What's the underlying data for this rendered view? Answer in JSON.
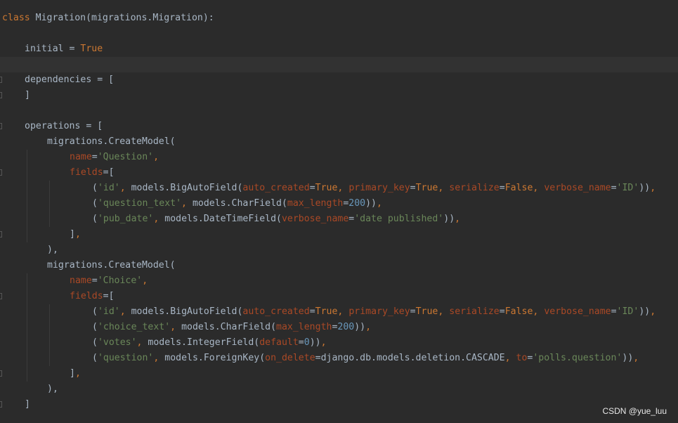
{
  "theme": {
    "background": "#2b2b2b",
    "current_line": "#323232",
    "keyword": "#cc7832",
    "parameter": "#aa4926",
    "string": "#6a8759",
    "number": "#6897bb",
    "text": "#a9b7c6"
  },
  "editor": {
    "language": "python",
    "current_line_index": 3,
    "lines": [
      {
        "indent": 0,
        "fold": false,
        "tokens": [
          [
            "kw",
            "class"
          ],
          [
            "txt",
            " Migration(migrations.Migration):"
          ]
        ]
      },
      {
        "indent": 0,
        "fold": false,
        "tokens": []
      },
      {
        "indent": 1,
        "fold": false,
        "tokens": [
          [
            "txt",
            "initial = "
          ],
          [
            "kw",
            "True"
          ]
        ]
      },
      {
        "indent": 0,
        "fold": false,
        "tokens": []
      },
      {
        "indent": 1,
        "fold": true,
        "tokens": [
          [
            "txt",
            "dependencies = ["
          ]
        ]
      },
      {
        "indent": 1,
        "fold": true,
        "tokens": [
          [
            "txt",
            "]"
          ]
        ]
      },
      {
        "indent": 0,
        "fold": false,
        "tokens": []
      },
      {
        "indent": 1,
        "fold": true,
        "tokens": [
          [
            "txt",
            "operations = ["
          ]
        ]
      },
      {
        "indent": 2,
        "fold": false,
        "tokens": [
          [
            "txt",
            "migrations.CreateModel("
          ]
        ]
      },
      {
        "indent": 3,
        "fold": false,
        "tokens": [
          [
            "par",
            "name"
          ],
          [
            "txt",
            "="
          ],
          [
            "str",
            "'Question'"
          ],
          [
            "kw",
            ","
          ]
        ]
      },
      {
        "indent": 3,
        "fold": true,
        "tokens": [
          [
            "par",
            "fields"
          ],
          [
            "txt",
            "=["
          ]
        ]
      },
      {
        "indent": 4,
        "fold": false,
        "tokens": [
          [
            "txt",
            "("
          ],
          [
            "str",
            "'id'"
          ],
          [
            "kw",
            ","
          ],
          [
            "txt",
            " models.BigAutoField("
          ],
          [
            "par",
            "auto_created"
          ],
          [
            "txt",
            "="
          ],
          [
            "kw",
            "True"
          ],
          [
            "kw",
            ","
          ],
          [
            "txt",
            " "
          ],
          [
            "par",
            "primary_key"
          ],
          [
            "txt",
            "="
          ],
          [
            "kw",
            "True"
          ],
          [
            "kw",
            ","
          ],
          [
            "txt",
            " "
          ],
          [
            "par",
            "serialize"
          ],
          [
            "txt",
            "="
          ],
          [
            "kw",
            "False"
          ],
          [
            "kw",
            ","
          ],
          [
            "txt",
            " "
          ],
          [
            "par",
            "verbose_name"
          ],
          [
            "txt",
            "="
          ],
          [
            "str",
            "'ID'"
          ],
          [
            "txt",
            "))"
          ],
          [
            "kw",
            ","
          ]
        ]
      },
      {
        "indent": 4,
        "fold": false,
        "tokens": [
          [
            "txt",
            "("
          ],
          [
            "str",
            "'question_text'"
          ],
          [
            "kw",
            ","
          ],
          [
            "txt",
            " models.CharField("
          ],
          [
            "par",
            "max_length"
          ],
          [
            "txt",
            "="
          ],
          [
            "num",
            "200"
          ],
          [
            "txt",
            "))"
          ],
          [
            "kw",
            ","
          ]
        ]
      },
      {
        "indent": 4,
        "fold": false,
        "tokens": [
          [
            "txt",
            "("
          ],
          [
            "str",
            "'pub_date'"
          ],
          [
            "kw",
            ","
          ],
          [
            "txt",
            " models.DateTimeField("
          ],
          [
            "par",
            "verbose_name"
          ],
          [
            "txt",
            "="
          ],
          [
            "str",
            "'date published'"
          ],
          [
            "txt",
            "))"
          ],
          [
            "kw",
            ","
          ]
        ]
      },
      {
        "indent": 3,
        "fold": true,
        "tokens": [
          [
            "txt",
            "]"
          ],
          [
            "kw",
            ","
          ]
        ]
      },
      {
        "indent": 2,
        "fold": false,
        "tokens": [
          [
            "txt",
            "),"
          ]
        ]
      },
      {
        "indent": 2,
        "fold": false,
        "tokens": [
          [
            "txt",
            "migrations.CreateModel("
          ]
        ]
      },
      {
        "indent": 3,
        "fold": false,
        "tokens": [
          [
            "par",
            "name"
          ],
          [
            "txt",
            "="
          ],
          [
            "str",
            "'Choice'"
          ],
          [
            "kw",
            ","
          ]
        ]
      },
      {
        "indent": 3,
        "fold": true,
        "tokens": [
          [
            "par",
            "fields"
          ],
          [
            "txt",
            "=["
          ]
        ]
      },
      {
        "indent": 4,
        "fold": false,
        "tokens": [
          [
            "txt",
            "("
          ],
          [
            "str",
            "'id'"
          ],
          [
            "kw",
            ","
          ],
          [
            "txt",
            " models.BigAutoField("
          ],
          [
            "par",
            "auto_created"
          ],
          [
            "txt",
            "="
          ],
          [
            "kw",
            "True"
          ],
          [
            "kw",
            ","
          ],
          [
            "txt",
            " "
          ],
          [
            "par",
            "primary_key"
          ],
          [
            "txt",
            "="
          ],
          [
            "kw",
            "True"
          ],
          [
            "kw",
            ","
          ],
          [
            "txt",
            " "
          ],
          [
            "par",
            "serialize"
          ],
          [
            "txt",
            "="
          ],
          [
            "kw",
            "False"
          ],
          [
            "kw",
            ","
          ],
          [
            "txt",
            " "
          ],
          [
            "par",
            "verbose_name"
          ],
          [
            "txt",
            "="
          ],
          [
            "str",
            "'ID'"
          ],
          [
            "txt",
            "))"
          ],
          [
            "kw",
            ","
          ]
        ]
      },
      {
        "indent": 4,
        "fold": false,
        "tokens": [
          [
            "txt",
            "("
          ],
          [
            "str",
            "'choice_text'"
          ],
          [
            "kw",
            ","
          ],
          [
            "txt",
            " models.CharField("
          ],
          [
            "par",
            "max_length"
          ],
          [
            "txt",
            "="
          ],
          [
            "num",
            "200"
          ],
          [
            "txt",
            "))"
          ],
          [
            "kw",
            ","
          ]
        ]
      },
      {
        "indent": 4,
        "fold": false,
        "tokens": [
          [
            "txt",
            "("
          ],
          [
            "str",
            "'votes'"
          ],
          [
            "kw",
            ","
          ],
          [
            "txt",
            " models.IntegerField("
          ],
          [
            "par",
            "default"
          ],
          [
            "txt",
            "="
          ],
          [
            "num",
            "0"
          ],
          [
            "txt",
            "))"
          ],
          [
            "kw",
            ","
          ]
        ]
      },
      {
        "indent": 4,
        "fold": false,
        "tokens": [
          [
            "txt",
            "("
          ],
          [
            "str",
            "'question'"
          ],
          [
            "kw",
            ","
          ],
          [
            "txt",
            " models.ForeignKey("
          ],
          [
            "par",
            "on_delete"
          ],
          [
            "txt",
            "=django.db.models.deletion.CASCADE"
          ],
          [
            "kw",
            ","
          ],
          [
            "txt",
            " "
          ],
          [
            "par",
            "to"
          ],
          [
            "txt",
            "="
          ],
          [
            "str",
            "'polls.question'"
          ],
          [
            "txt",
            "))"
          ],
          [
            "kw",
            ","
          ]
        ]
      },
      {
        "indent": 3,
        "fold": true,
        "tokens": [
          [
            "txt",
            "]"
          ],
          [
            "kw",
            ","
          ]
        ]
      },
      {
        "indent": 2,
        "fold": false,
        "tokens": [
          [
            "txt",
            "),"
          ]
        ]
      },
      {
        "indent": 1,
        "fold": true,
        "tokens": [
          [
            "txt",
            "]"
          ]
        ]
      }
    ]
  },
  "watermark": {
    "text": "CSDN @yue_luu"
  }
}
